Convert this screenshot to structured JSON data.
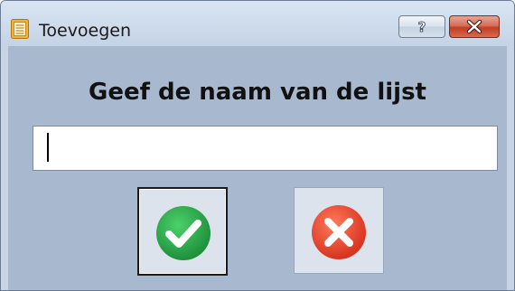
{
  "window": {
    "title": "Toevoegen",
    "icon": "list-document-icon",
    "help_icon": "question-mark-icon",
    "close_icon": "close-x-icon"
  },
  "dialog": {
    "prompt": "Geef de naam van de lijst",
    "input": {
      "value": "",
      "placeholder": ""
    },
    "ok_icon": "green-check-icon",
    "cancel_icon": "red-x-icon"
  },
  "colors": {
    "ok_green": "#2aa84a",
    "cancel_red": "#e8452e",
    "client_bg": "#a8b8cf"
  }
}
